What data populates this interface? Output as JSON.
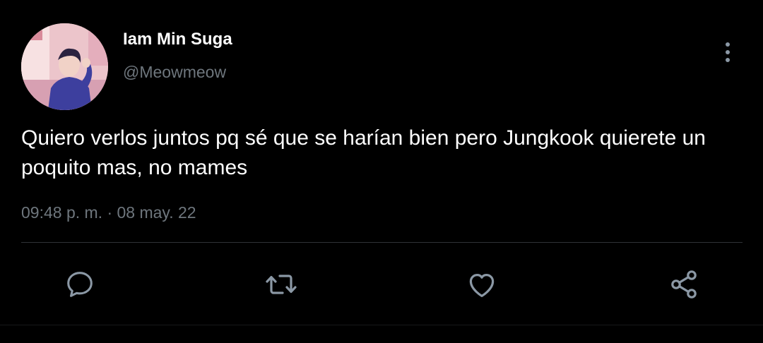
{
  "tweet": {
    "author": {
      "display_name": "Iam Min Suga",
      "handle": "@Meowmeow"
    },
    "text": "Quiero verlos juntos pq sé que se harían bien pero Jungkook quierete un poquito mas, no mames",
    "timestamp": "09:48 p. m. · 08 may. 22"
  },
  "actions": [
    {
      "icon": "reply-icon"
    },
    {
      "icon": "retweet-icon"
    },
    {
      "icon": "like-icon"
    },
    {
      "icon": "share-icon"
    }
  ],
  "colors": {
    "background": "#000000",
    "primary_text": "#ffffff",
    "secondary_text": "#6e767d",
    "icon": "#8b98a5",
    "divider": "#2f3336"
  }
}
